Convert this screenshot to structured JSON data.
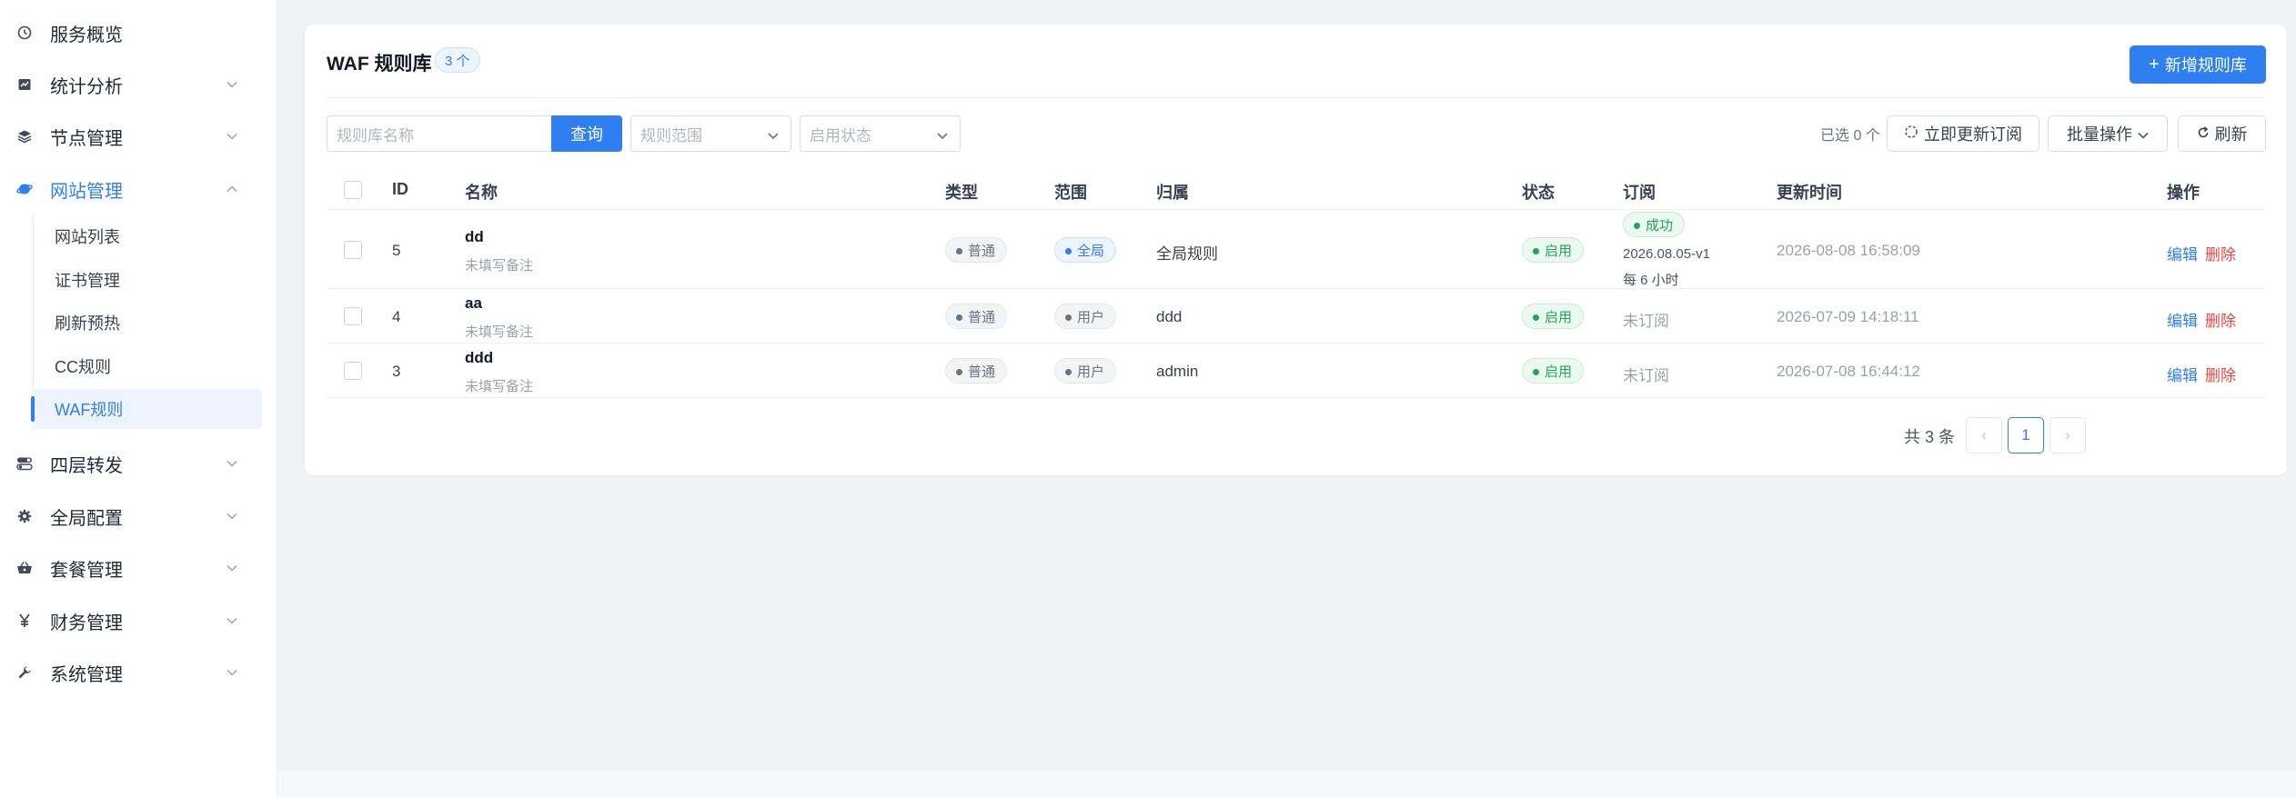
{
  "sidebar": {
    "items": [
      {
        "label": "服务概览",
        "icon": "dashboard-icon"
      },
      {
        "label": "统计分析",
        "icon": "chart-icon"
      },
      {
        "label": "节点管理",
        "icon": "layers-icon"
      },
      {
        "label": "网站管理",
        "icon": "globe-icon"
      },
      {
        "label": "四层转发",
        "icon": "toggle-icon"
      },
      {
        "label": "全局配置",
        "icon": "gear-icon"
      },
      {
        "label": "套餐管理",
        "icon": "basket-icon"
      },
      {
        "label": "财务管理",
        "icon": "yen-icon"
      },
      {
        "label": "系统管理",
        "icon": "wrench-icon"
      }
    ],
    "submenu": [
      {
        "label": "网站列表"
      },
      {
        "label": "证书管理"
      },
      {
        "label": "刷新预热"
      },
      {
        "label": "CC规则"
      },
      {
        "label": "WAF规则"
      }
    ]
  },
  "card": {
    "title": "WAF 规则库",
    "count_badge": "3 个",
    "add_button": "新增规则库"
  },
  "filters": {
    "name_placeholder": "规则库名称",
    "query_button": "查询",
    "scope_placeholder": "规则范围",
    "status_placeholder": "启用状态",
    "selected_text": "已选 0 个",
    "update_subscription": "立即更新订阅",
    "batch_ops": "批量操作",
    "refresh": "刷新"
  },
  "table": {
    "headers": {
      "id": "ID",
      "name": "名称",
      "type": "类型",
      "scope": "范围",
      "owner": "归属",
      "status": "状态",
      "subscription": "订阅",
      "updated": "更新时间",
      "actions": "操作"
    },
    "rows": [
      {
        "id": "5",
        "name": "dd",
        "remark": "未填写备注",
        "type": "普通",
        "scope": "全局",
        "owner": "全局规则",
        "status": "启用",
        "sub_status": "成功",
        "sub_version": "2026.08.05-v1",
        "sub_interval": "每 6 小时",
        "updated": "2026-08-08 16:58:09",
        "edit": "编辑",
        "delete": "删除"
      },
      {
        "id": "4",
        "name": "aa",
        "remark": "未填写备注",
        "type": "普通",
        "scope": "用户",
        "owner": "ddd",
        "status": "启用",
        "sub_text": "未订阅",
        "updated": "2026-07-09 14:18:11",
        "edit": "编辑",
        "delete": "删除"
      },
      {
        "id": "3",
        "name": "ddd",
        "remark": "未填写备注",
        "type": "普通",
        "scope": "用户",
        "owner": "admin",
        "status": "启用",
        "sub_text": "未订阅",
        "updated": "2026-07-08 16:44:12",
        "edit": "编辑",
        "delete": "删除"
      }
    ]
  },
  "pagination": {
    "total": "共 3 条",
    "current": "1",
    "prev": "‹",
    "next": "›"
  },
  "colors": {
    "accent": "#2f7ff0",
    "success": "#22a559",
    "danger": "#ef4444"
  }
}
